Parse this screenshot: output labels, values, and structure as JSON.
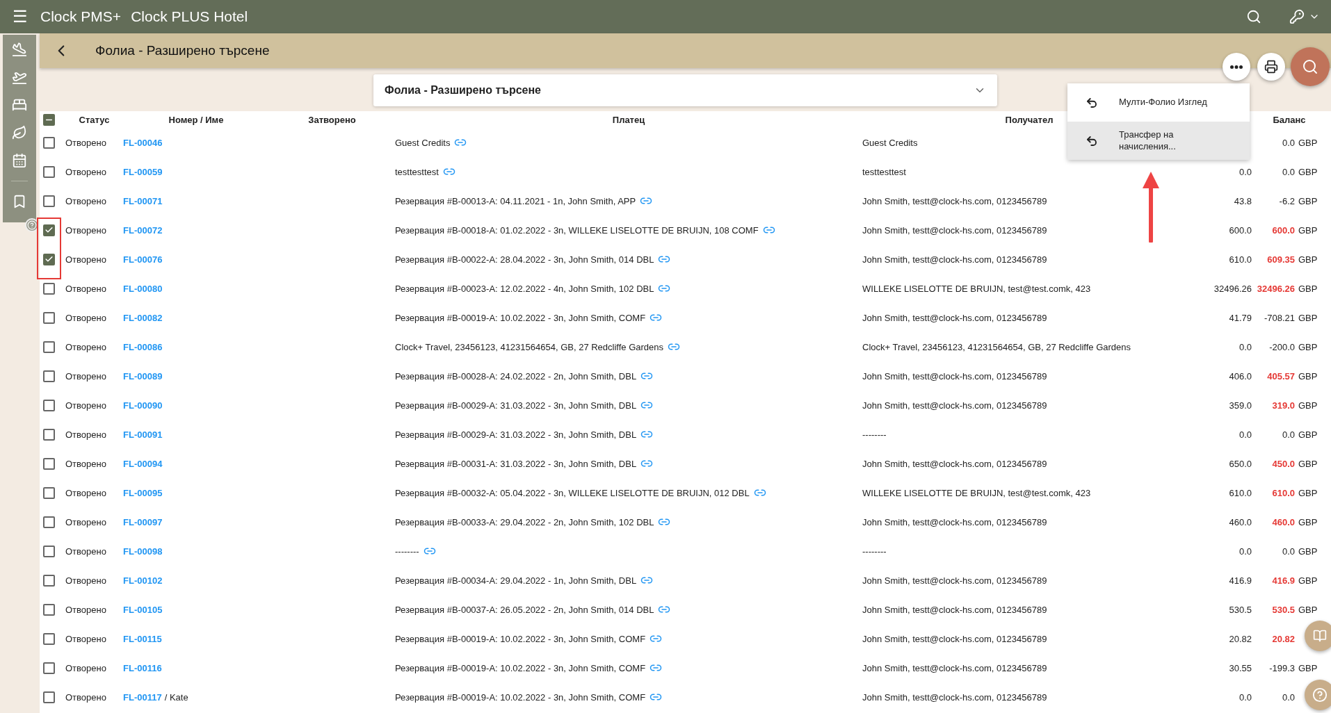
{
  "app_bar": {
    "menu": "☰",
    "product": "Clock PMS+",
    "hotel": "Clock PLUS Hotel"
  },
  "page": {
    "title": "Фолиа - Разширено търсене",
    "view_select": "Фолиа - Разширено търсене"
  },
  "actions_menu": {
    "items": [
      {
        "label": "Мулти-Фолио Изглед",
        "selected": false
      },
      {
        "label": "Трансфер на начисления...",
        "selected": true
      }
    ]
  },
  "table": {
    "header_checkbox": {
      "indeterminate": true
    },
    "columns": [
      {
        "label": "Статус"
      },
      {
        "label": "Номер / Име"
      },
      {
        "label": "Затворено"
      },
      {
        "label": "Платец"
      },
      {
        "label": "Получател"
      },
      {
        "label": "Баланс"
      }
    ],
    "rows": [
      {
        "selected": false,
        "status": "Отворено",
        "number": "FL-00046",
        "payer": "Guest Credits",
        "receiver": "Guest Credits",
        "balance": "0.0",
        "overdue": false,
        "currency": "GBP"
      },
      {
        "selected": false,
        "status": "Отворено",
        "number": "FL-00059",
        "payer": "testtesttest",
        "receiver": "testtesttest",
        "amount": "0.0",
        "balance": "0.0",
        "overdue": false,
        "currency": "GBP"
      },
      {
        "selected": false,
        "status": "Отворено",
        "number": "FL-00071",
        "payer": "Резервация #B-00013-A: 04.11.2021 - 1n, John Smith, APP",
        "receiver": "John Smith, testt@clock-hs.com, 0123456789",
        "amount": "43.8",
        "balance": "-6.2",
        "overdue": false,
        "currency": "GBP"
      },
      {
        "selected": true,
        "status": "Отворено",
        "number": "FL-00072",
        "payer": "Резервация #B-00018-A: 01.02.2022 - 3n, WILLEKE LISELOTTE DE BRUIJN, 108 COMF",
        "receiver": "John Smith, testt@clock-hs.com, 0123456789",
        "amount": "600.0",
        "balance": "600.0",
        "overdue": true,
        "currency": "GBP"
      },
      {
        "selected": true,
        "status": "Отворено",
        "number": "FL-00076",
        "payer": "Резервация #B-00022-A: 28.04.2022 - 3n, John Smith, 014 DBL",
        "receiver": "John Smith, testt@clock-hs.com, 0123456789",
        "amount": "610.0",
        "balance": "609.35",
        "overdue": true,
        "currency": "GBP"
      },
      {
        "selected": false,
        "status": "Отворено",
        "number": "FL-00080",
        "payer": "Резервация #B-00023-A: 12.02.2022 - 4n, John Smith, 102 DBL",
        "receiver": "WILLEKE LISELOTTE DE BRUIJN, test@test.comk, 423",
        "amount": "32496.26",
        "balance": "32496.26",
        "overdue": true,
        "currency": "GBP"
      },
      {
        "selected": false,
        "status": "Отворено",
        "number": "FL-00082",
        "payer": "Резервация #B-00019-A: 10.02.2022 - 3n, John Smith, COMF",
        "receiver": "John Smith, testt@clock-hs.com, 0123456789",
        "amount": "41.79",
        "balance": "-708.21",
        "overdue": false,
        "currency": "GBP"
      },
      {
        "selected": false,
        "status": "Отворено",
        "number": "FL-00086",
        "payer": "Clock+ Travel, 23456123, 41231564654, GB, 27 Redcliffe Gardens",
        "receiver": "Clock+ Travel, 23456123, 41231564654, GB, 27 Redcliffe Gardens",
        "amount": "0.0",
        "balance": "-200.0",
        "overdue": false,
        "currency": "GBP"
      },
      {
        "selected": false,
        "status": "Отворено",
        "number": "FL-00089",
        "payer": "Резервация #B-00028-A: 24.02.2022 - 2n, John Smith, DBL",
        "receiver": "John Smith, testt@clock-hs.com, 0123456789",
        "amount": "406.0",
        "balance": "405.57",
        "overdue": true,
        "currency": "GBP"
      },
      {
        "selected": false,
        "status": "Отворено",
        "number": "FL-00090",
        "payer": "Резервация #B-00029-A: 31.03.2022 - 3n, John Smith, DBL",
        "receiver": "John Smith, testt@clock-hs.com, 0123456789",
        "amount": "359.0",
        "balance": "319.0",
        "overdue": true,
        "currency": "GBP"
      },
      {
        "selected": false,
        "status": "Отворено",
        "number": "FL-00091",
        "payer": "Резервация #B-00029-A: 31.03.2022 - 3n, John Smith, DBL",
        "receiver": "--------",
        "amount": "0.0",
        "balance": "0.0",
        "overdue": false,
        "currency": "GBP"
      },
      {
        "selected": false,
        "status": "Отворено",
        "number": "FL-00094",
        "payer": "Резервация #B-00031-A: 31.03.2022 - 3n, John Smith, DBL",
        "receiver": "John Smith, testt@clock-hs.com, 0123456789",
        "amount": "650.0",
        "balance": "450.0",
        "overdue": true,
        "currency": "GBP"
      },
      {
        "selected": false,
        "status": "Отворено",
        "number": "FL-00095",
        "payer": "Резервация #B-00032-A: 05.04.2022 - 3n, WILLEKE LISELOTTE DE BRUIJN, 012 DBL",
        "receiver": "WILLEKE LISELOTTE DE BRUIJN, test@test.comk, 423",
        "amount": "610.0",
        "balance": "610.0",
        "overdue": true,
        "currency": "GBP"
      },
      {
        "selected": false,
        "status": "Отворено",
        "number": "FL-00097",
        "payer": "Резервация #B-00033-A: 29.04.2022 - 2n, John Smith, 102 DBL",
        "receiver": "John Smith, testt@clock-hs.com, 0123456789",
        "amount": "460.0",
        "balance": "460.0",
        "overdue": true,
        "currency": "GBP"
      },
      {
        "selected": false,
        "status": "Отворено",
        "number": "FL-00098",
        "payer": "--------",
        "receiver": "--------",
        "amount": "0.0",
        "balance": "0.0",
        "overdue": false,
        "currency": "GBP"
      },
      {
        "selected": false,
        "status": "Отворено",
        "number": "FL-00102",
        "payer": "Резервация #B-00034-A: 29.04.2022 - 1n, John Smith, DBL",
        "receiver": "John Smith, testt@clock-hs.com, 0123456789",
        "amount": "416.9",
        "balance": "416.9",
        "overdue": true,
        "currency": "GBP"
      },
      {
        "selected": false,
        "status": "Отворено",
        "number": "FL-00105",
        "payer": "Резервация #B-00037-A: 26.05.2022 - 2n, John Smith, 014 DBL",
        "receiver": "John Smith, testt@clock-hs.com, 0123456789",
        "amount": "530.5",
        "balance": "530.5",
        "overdue": true,
        "currency": "GBP"
      },
      {
        "selected": false,
        "status": "Отворено",
        "number": "FL-00115",
        "payer": "Резервация #B-00019-A: 10.02.2022 - 3n, John Smith, COMF",
        "receiver": "John Smith, testt@clock-hs.com, 0123456789",
        "amount": "20.82",
        "balance": "20.82",
        "overdue": true
      },
      {
        "selected": false,
        "status": "Отворено",
        "number": "FL-00116",
        "payer": "Резервация #B-00019-A: 10.02.2022 - 3n, John Smith, COMF",
        "receiver": "John Smith, testt@clock-hs.com, 0123456789",
        "amount": "30.55",
        "balance": "-199.3",
        "overdue": false,
        "currency": "GBP"
      },
      {
        "selected": false,
        "status": "Отворено",
        "number": "FL-00117",
        "name": "/ Kate",
        "payer": "Резервация #B-00019-A: 10.02.2022 - 3n, John Smith, COMF",
        "receiver": "John Smith, testt@clock-hs.com, 0123456789",
        "amount": "0.0",
        "balance": "0.0",
        "overdue": false
      }
    ]
  }
}
